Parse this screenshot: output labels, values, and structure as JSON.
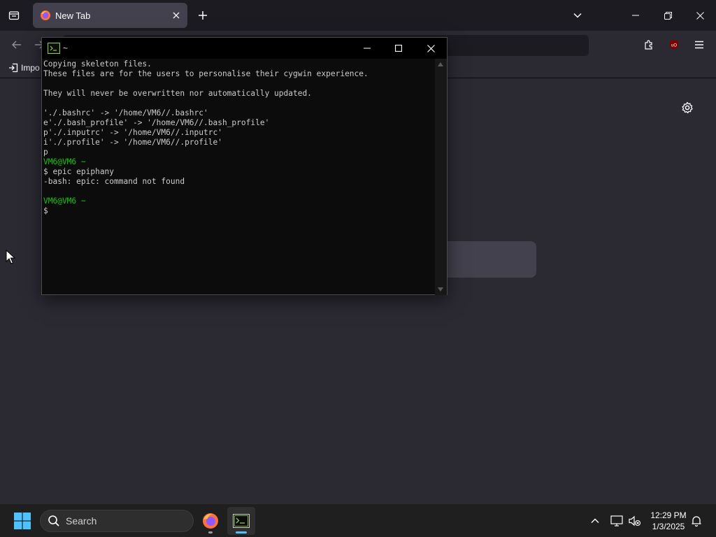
{
  "browser": {
    "tab_title": "New Tab",
    "bookmark_label": "Impo"
  },
  "terminal": {
    "title": "~",
    "lines": [
      {
        "text": "Copying skeleton files.",
        "color": "white"
      },
      {
        "text": "These files are for the users to personalise their cygwin experience.",
        "color": "white"
      },
      {
        "text": "",
        "color": "white"
      },
      {
        "text": "They will never be overwritten nor automatically updated.",
        "color": "white"
      },
      {
        "text": "",
        "color": "white"
      },
      {
        "text": "'./.bashrc' -> '/home/VM6//.bashrc'",
        "color": "white"
      },
      {
        "text": "e'./.bash_profile' -> '/home/VM6//.bash_profile'",
        "color": "white"
      },
      {
        "text": "p'./.inputrc' -> '/home/VM6//.inputrc'",
        "color": "white"
      },
      {
        "text": "i'./.profile' -> '/home/VM6//.profile'",
        "color": "white"
      },
      {
        "text": "p",
        "color": "white"
      },
      {
        "text": "VM6@VM6 ~",
        "color": "green"
      },
      {
        "text": "$ epic epiphany",
        "color": "white"
      },
      {
        "text": "-bash: epic: command not found",
        "color": "white"
      },
      {
        "text": "",
        "color": "white"
      },
      {
        "text": "VM6@VM6 ~",
        "color": "green"
      },
      {
        "text": "$",
        "color": "white"
      }
    ]
  },
  "taskbar": {
    "search_label": "Search",
    "time": "12:29 PM",
    "date": "1/3/2025"
  },
  "colors": {
    "prompt_green": "#16c60c",
    "terminal_text": "#cccccc",
    "terminal_bg": "#0c0c0c",
    "browser_bg": "#2b2a33",
    "tabstrip_bg": "#1c1b22"
  }
}
